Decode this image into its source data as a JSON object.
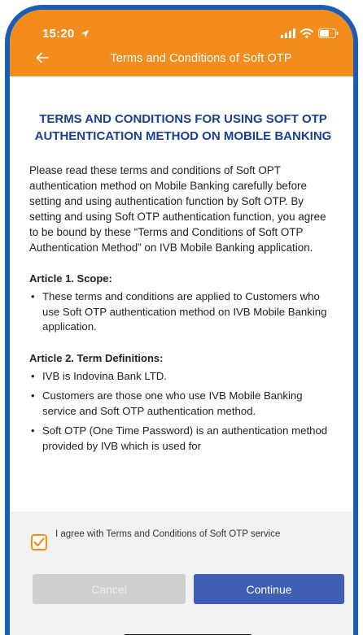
{
  "status_bar": {
    "time": "15:20",
    "icons": [
      "location-arrow-icon",
      "cellular-signal-icon",
      "wifi-icon",
      "battery-icon"
    ]
  },
  "nav": {
    "back_icon": "arrow-left-icon",
    "title": "Terms and Conditions of Soft OTP"
  },
  "document": {
    "title": "TERMS AND CONDITIONS FOR USING SOFT OTP AUTHENTICATION METHOD ON MOBILE BANKING",
    "intro": "Please read these terms and conditions of Soft OPT authentication method on Mobile Banking carefully before setting and using authentication function by Soft OTP. By setting and using Soft OTP authentication function, you agree to be bound by these “Terms and Conditions of Soft OTP Authentication Method” on IVB Mobile Banking application.",
    "articles": [
      {
        "heading": "Article 1. Scope:",
        "items": [
          "These terms and conditions are applied to Customers who use Soft OTP authentication method on IVB Mobile Banking application."
        ]
      },
      {
        "heading": "Article 2. Term Definitions:",
        "items": [
          "IVB is Indovina Bank LTD.",
          "Customers are those one who use IVB Mobile Banking service and Soft OTP authentication method.",
          "Soft OTP (One Time Password) is an authentication method provided by IVB which is used for"
        ]
      }
    ]
  },
  "footer": {
    "agree_checked": true,
    "agree_label": "I agree with Terms and Conditions of Soft OTP service",
    "cancel_label": "Cancel",
    "continue_label": "Continue"
  },
  "colors": {
    "header": "#f28c1c",
    "title": "#1b3f93",
    "primary_button": "#3f5fb4",
    "disabled_button": "#cfcfcf",
    "frame": "#1a5db3"
  }
}
